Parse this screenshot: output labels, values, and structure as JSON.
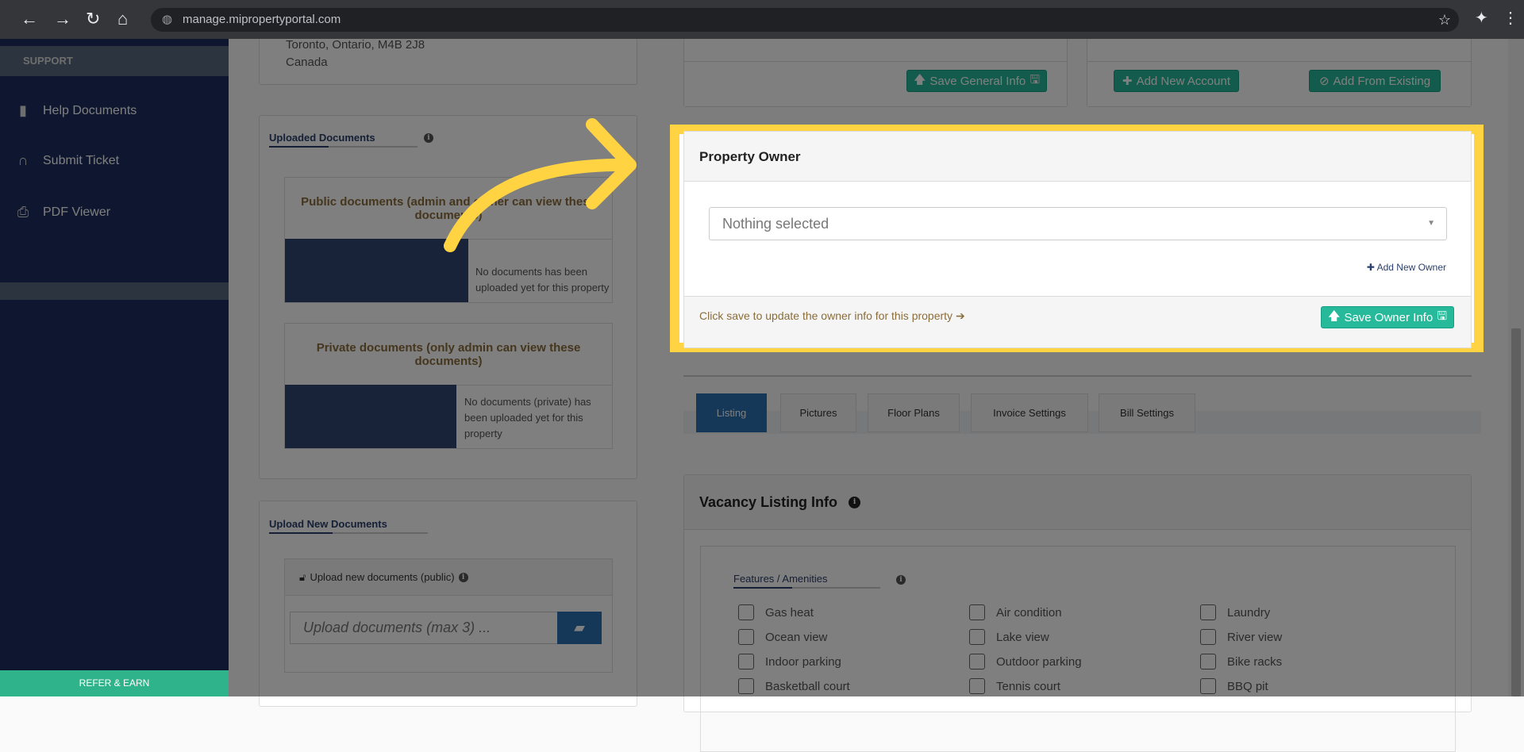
{
  "browser": {
    "url": "manage.mipropertyportal.com"
  },
  "sidebar": {
    "section": "SUPPORT",
    "items": [
      {
        "label": "Help Documents",
        "icon": "book-icon"
      },
      {
        "label": "Submit Ticket",
        "icon": "headset-icon"
      },
      {
        "label": "PDF Viewer",
        "icon": "pdf-icon"
      }
    ],
    "refer": "REFER & EARN"
  },
  "address": {
    "line": "Toronto, Ontario, M4B 2J8",
    "country": "Canada"
  },
  "uploaded": {
    "title": "Uploaded Documents",
    "public_title": "Public documents (admin and owner can view these documents)",
    "public_msg": "No documents has been uploaded yet for this property",
    "private_title": "Private documents (only admin can view these documents)",
    "private_msg": "No documents (private) has been uploaded yet for this property"
  },
  "upload_new": {
    "title": "Upload New Documents",
    "box_title": "Upload new documents (public)",
    "placeholder": "Upload documents (max 3) ..."
  },
  "general": {
    "save": "Save General Info"
  },
  "accounts": {
    "add_new": "Add New Account",
    "add_existing": "Add From Existing"
  },
  "owner": {
    "title": "Property Owner",
    "select_value": "Nothing selected",
    "add_owner": "Add New Owner",
    "hint": "Click save to update the owner info for this property",
    "save": "Save Owner Info"
  },
  "tabs": [
    "Listing",
    "Pictures",
    "Floor Plans",
    "Invoice Settings",
    "Bill Settings"
  ],
  "vacancy": {
    "title": "Vacancy Listing Info",
    "features_title": "Features / Amenities",
    "features": [
      "Gas heat",
      "Air condition",
      "Laundry",
      "Ocean view",
      "Lake view",
      "River view",
      "Indoor parking",
      "Outdoor parking",
      "Bike racks",
      "Basketball court",
      "Tennis court",
      "BBQ pit"
    ]
  }
}
